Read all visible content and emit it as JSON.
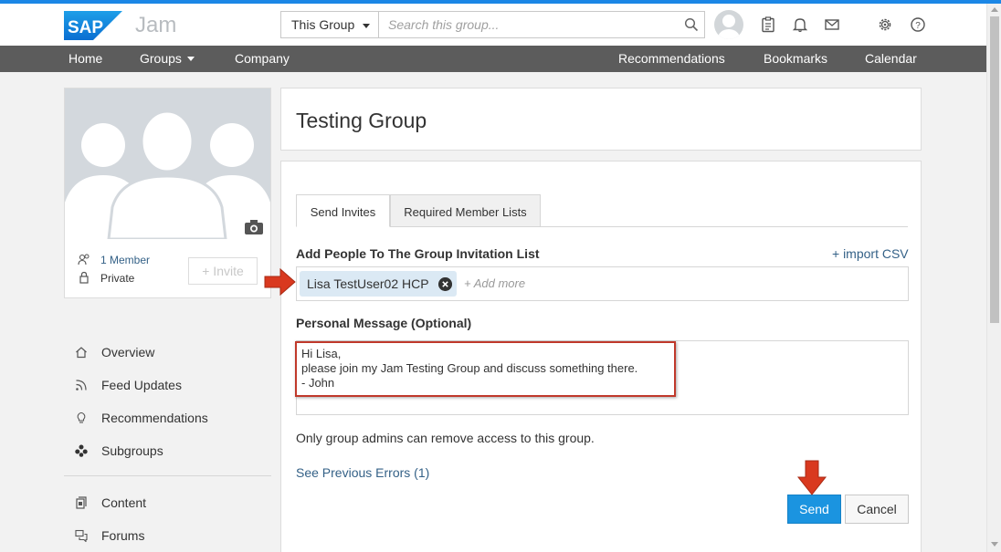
{
  "header": {
    "app_name": "Jam",
    "scope_select": "This Group",
    "search_placeholder": "Search this group..."
  },
  "nav": {
    "items": [
      "Home",
      "Groups",
      "Company"
    ],
    "right_items": [
      "Recommendations",
      "Bookmarks",
      "Calendar"
    ]
  },
  "group_card": {
    "members": "1 Member",
    "visibility": "Private",
    "invite_label": "+ Invite"
  },
  "sidebar": {
    "items": [
      {
        "label": "Overview",
        "icon": "home-icon"
      },
      {
        "label": "Feed Updates",
        "icon": "rss-icon"
      },
      {
        "label": "Recommendations",
        "icon": "lightbulb-icon"
      },
      {
        "label": "Subgroups",
        "icon": "subgroups-icon"
      },
      {
        "label": "Content",
        "icon": "content-icon"
      },
      {
        "label": "Forums",
        "icon": "forums-icon"
      }
    ]
  },
  "main": {
    "title": "Testing Group",
    "tabs": [
      {
        "label": "Send Invites",
        "active": true
      },
      {
        "label": "Required Member Lists",
        "active": false
      }
    ],
    "invite_section_label": "Add People To The Group Invitation List",
    "import_label": "+ import CSV",
    "invitee": "Lisa TestUser02 HCP",
    "add_more_placeholder": "+ Add more",
    "message_label": "Personal Message (Optional)",
    "message_lines": [
      "Hi Lisa,",
      "please join my Jam Testing Group and discuss something there.",
      "- John"
    ],
    "info_text": "Only group admins can remove access to this group.",
    "errors_link": "See Previous Errors (1)",
    "send_label": "Send",
    "cancel_label": "Cancel"
  },
  "colors": {
    "accent_blue": "#1b94e0",
    "link_blue": "#346187",
    "nav_bar": "#5c5c5c",
    "annotation_red": "#c0392b"
  }
}
